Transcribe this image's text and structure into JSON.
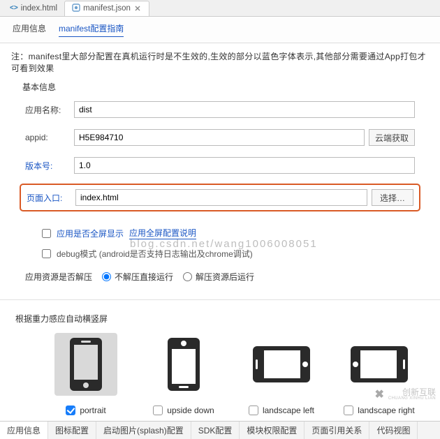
{
  "file_tabs": {
    "inactive": "index.html",
    "active": "manifest.json"
  },
  "sub_tabs": {
    "info_label": "应用信息",
    "guide_link": "manifest配置指南"
  },
  "note": "注：manifest里大部分配置在真机运行时是不生效的,生效的部分以蓝色字体表示,其他部分需要通过App打包才可看到效果",
  "basic_section_title": "基本信息",
  "form": {
    "app_name": {
      "label": "应用名称:",
      "value": "dist"
    },
    "appid": {
      "label": "appid:",
      "value": "H5E984710",
      "cloud_btn": "云端获取"
    },
    "version": {
      "label": "版本号:",
      "value": "1.0"
    },
    "entry": {
      "label": "页面入口:",
      "value": "index.html",
      "choose_btn": "选择…"
    }
  },
  "options": {
    "fullscreen": {
      "label": "应用是否全屏显示",
      "link": "应用全屏配置说明"
    },
    "debug": {
      "label": "debug模式 (android是否支持日志输出及chrome调试)"
    },
    "resource": {
      "label": "应用资源是否解压",
      "opt1": "不解压直接运行",
      "opt2": "解压资源后运行"
    }
  },
  "url_overlay": "blog.csdn.net/wang1006008051",
  "orientation": {
    "title": "根据重力感应自动横竖屏",
    "items": [
      {
        "key": "portrait",
        "label": "portrait",
        "checked": true
      },
      {
        "key": "upside-down",
        "label": "upside down",
        "checked": false
      },
      {
        "key": "landscape-left",
        "label": "landscape left",
        "checked": false
      },
      {
        "key": "landscape-right",
        "label": "landscape right",
        "checked": false
      }
    ]
  },
  "bottom_tabs": [
    "应用信息",
    "图标配置",
    "启动图片(splash)配置",
    "SDK配置",
    "模块权限配置",
    "页面引用关系",
    "代码视图"
  ],
  "bottom_active_index": 0,
  "watermark": {
    "brand_zh": "创新互联",
    "brand_en": "CHUANG XINHU LIAN"
  }
}
